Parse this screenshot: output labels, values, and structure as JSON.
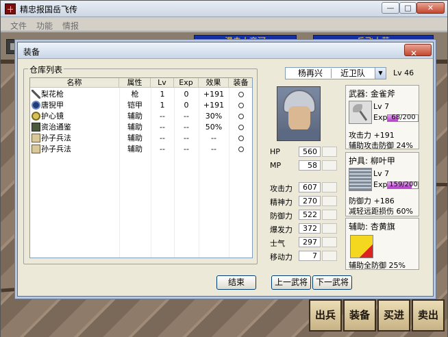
{
  "window": {
    "title": "精忠报国岳飞传"
  },
  "menu": [
    "文件",
    "功能",
    "情报"
  ],
  "banners": [
    "温击小商河",
    "岳飞大营"
  ],
  "actions": [
    "出兵",
    "装备",
    "买进",
    "卖出"
  ],
  "dialog": {
    "title": "装备",
    "close_icon": "close-icon",
    "inventory": {
      "legend": "仓库列表",
      "columns": [
        "名称",
        "属性",
        "Lv",
        "Exp",
        "效果",
        "装备"
      ],
      "rows": [
        {
          "icon": "spear-icon",
          "name": "梨花枪",
          "attr": "枪",
          "lv": "1",
          "exp": "0",
          "effect": "+191"
        },
        {
          "icon": "armor-icon",
          "name": "唐猊甲",
          "attr": "铠甲",
          "lv": "1",
          "exp": "0",
          "effect": "+191"
        },
        {
          "icon": "mirror-icon",
          "name": "护心镜",
          "attr": "辅助",
          "lv": "--",
          "exp": "--",
          "effect": "30%"
        },
        {
          "icon": "book-icon",
          "name": "资治通鉴",
          "attr": "辅助",
          "lv": "--",
          "exp": "--",
          "effect": "50%"
        },
        {
          "icon": "scroll-icon",
          "name": "孙子兵法",
          "attr": "辅助",
          "lv": "--",
          "exp": "--",
          "effect": "--"
        },
        {
          "icon": "scroll-icon",
          "name": "孙子兵法",
          "attr": "辅助",
          "lv": "--",
          "exp": "--",
          "effect": "--"
        }
      ]
    },
    "end_button": "结束",
    "hero": {
      "name": "杨再兴",
      "team": "近卫队",
      "lv": "Lv 46",
      "stats": [
        {
          "label": "HP",
          "value": "560"
        },
        {
          "label": "MP",
          "value": "58"
        },
        {
          "label": "攻击力",
          "value": "607"
        },
        {
          "label": "精神力",
          "value": "270"
        },
        {
          "label": "防御力",
          "value": "522"
        },
        {
          "label": "爆发力",
          "value": "372"
        },
        {
          "label": "士气",
          "value": "297"
        },
        {
          "label": "移动力",
          "value": "7"
        }
      ]
    },
    "prev_button": "上一武将",
    "next_button": "下一武将",
    "weapon": {
      "label": "武器:",
      "name": "金雀斧",
      "lv": "Lv  7",
      "exp_label": "Exp",
      "exp_text": "68/200",
      "exp_fraction": 0.34,
      "line1": "攻击力 +191",
      "line2": "辅助攻击防御 24%"
    },
    "armor": {
      "label": "护具:",
      "name": "柳叶甲",
      "lv": "Lv  7",
      "exp_label": "Exp",
      "exp_text": "159/200",
      "exp_fraction": 0.795,
      "line1": "防御力 +186",
      "line2": "减轻远距损伤 60%"
    },
    "accessory": {
      "label": "辅助:",
      "name": "杏黄旗",
      "line1": "辅助全防御 25%"
    }
  }
}
